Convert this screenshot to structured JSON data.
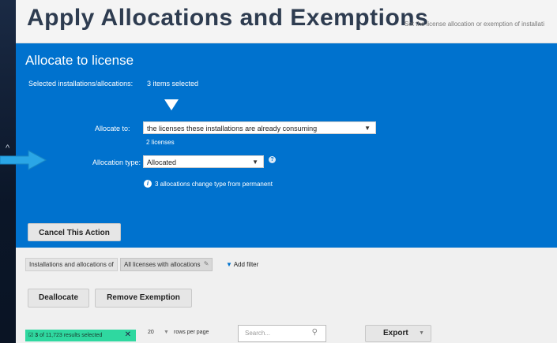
{
  "header": {
    "title": "Apply Allocations and Exemptions",
    "subtitle": "Set the license allocation or exemption of installati"
  },
  "form": {
    "title": "Allocate to license",
    "selected_label": "Selected installations/allocations:",
    "selected_value": "3 items selected",
    "allocate_to_label": "Allocate to:",
    "allocate_to_value": "the licenses these installations are already consuming",
    "licenses_count": "2 licenses",
    "allocation_type_label": "Allocation type:",
    "allocation_type_value": "Allocated",
    "info_message": "3 allocations change type from permanent",
    "cancel_label": "Cancel This Action"
  },
  "filters": {
    "prefix": "Installations and allocations of",
    "current": "All licenses with allocations",
    "add_filter": "Add filter"
  },
  "actions": {
    "deallocate": "Deallocate",
    "remove_exemption": "Remove Exemption"
  },
  "table_controls": {
    "selected_count": "3",
    "selected_text": "of 11,723 results selected",
    "rows_per_page_value": "20",
    "rows_per_page_label": "rows per page",
    "search_placeholder": "Search...",
    "export_label": "Export"
  },
  "colors": {
    "accent": "#0072ce",
    "selected_pill": "#2fd8a0",
    "arrow": "#2aa6e6"
  }
}
